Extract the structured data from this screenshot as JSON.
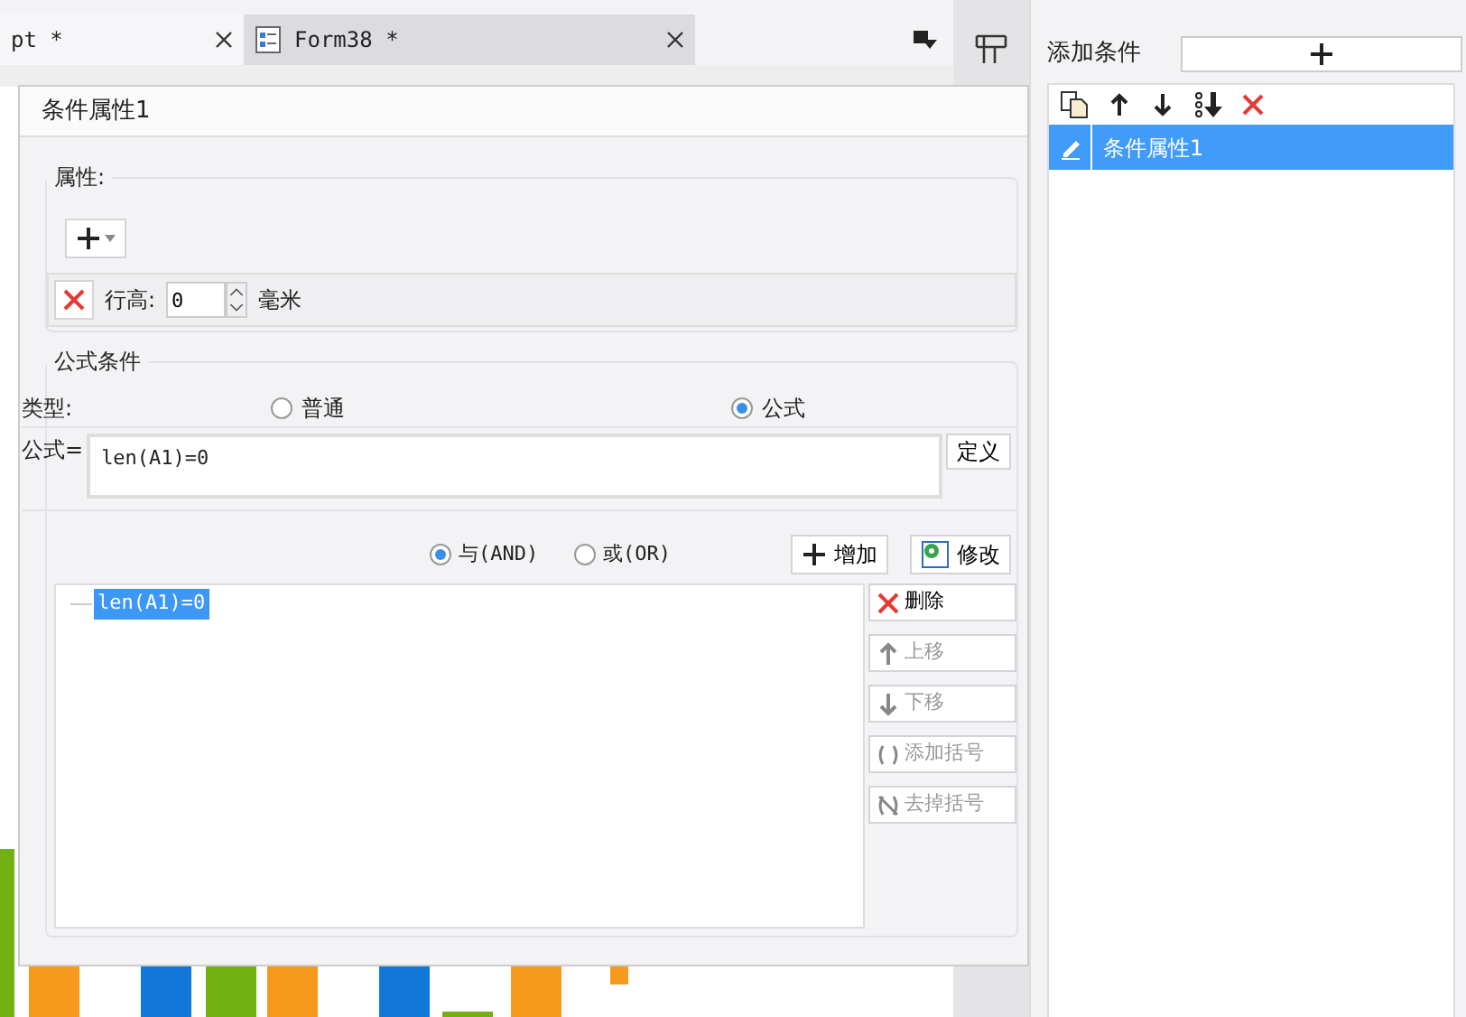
{
  "editor_tabs": [
    {
      "label": "pt *",
      "selected": true,
      "icon": false
    },
    {
      "label": "Form38 *",
      "selected": false,
      "icon": true
    }
  ],
  "right_panel": {
    "add_condition_label": "添加条件",
    "conditions": [
      {
        "label": "条件属性1",
        "selected": true
      }
    ]
  },
  "dialog": {
    "title": "条件属性1",
    "attributes": {
      "legend": "属性:",
      "rows": [
        {
          "label": "行高:",
          "value": "0",
          "unit": "毫米"
        }
      ]
    },
    "formula": {
      "legend": "公式条件",
      "type_label": "类型:",
      "types": [
        {
          "label": "普通",
          "selected": false
        },
        {
          "label": "公式",
          "selected": true
        }
      ],
      "formula_label": "公式=",
      "formula_value": "len(A1)=0",
      "define_button": "定义",
      "joins": [
        {
          "label": "与(AND)",
          "selected": true
        },
        {
          "label": "或(OR)",
          "selected": false
        }
      ],
      "add_button": "增加",
      "edit_button": "修改",
      "conditions": [
        {
          "text": "len(A1)=0",
          "selected": true
        }
      ],
      "actions": [
        {
          "kind": "delete",
          "label": "删除",
          "disabled": false
        },
        {
          "kind": "up",
          "label": "上移",
          "disabled": true
        },
        {
          "kind": "down",
          "label": "下移",
          "disabled": true
        },
        {
          "kind": "paren-add",
          "label": "添加括号",
          "disabled": true
        },
        {
          "kind": "paren-remove",
          "label": "去掉括号",
          "disabled": true
        }
      ]
    }
  }
}
